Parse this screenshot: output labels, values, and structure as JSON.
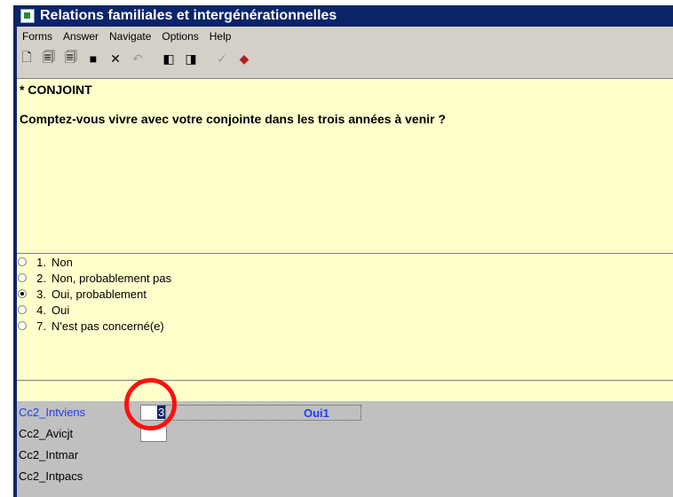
{
  "window": {
    "title": "Relations familiales et intergénérationnelles"
  },
  "menu": [
    "Forms",
    "Answer",
    "Navigate",
    "Options",
    "Help"
  ],
  "toolbar": [
    {
      "icon": "new-doc-icon",
      "glyph": "🗋"
    },
    {
      "icon": "page-icon",
      "glyph": "🗐"
    },
    {
      "icon": "copy-pages-icon",
      "glyph": "🗐"
    },
    {
      "icon": "save-icon",
      "glyph": "■"
    },
    {
      "icon": "delete-icon",
      "glyph": "✕"
    },
    {
      "icon": "undo-icon",
      "glyph": "↶"
    },
    {
      "icon": "prev-form-icon",
      "glyph": "◧"
    },
    {
      "icon": "next-form-icon",
      "glyph": "◨"
    },
    {
      "icon": "check-icon",
      "glyph": "✓"
    },
    {
      "icon": "eraser-icon",
      "glyph": "◆"
    }
  ],
  "question": {
    "heading": "* CONJOINT",
    "text": "Comptez-vous vivre avec votre conjointe dans les trois années à venir ?"
  },
  "answers": [
    {
      "num": "1.",
      "label": "Non",
      "selected": false
    },
    {
      "num": "2.",
      "label": "Non, probablement pas",
      "selected": false
    },
    {
      "num": "3.",
      "label": "Oui, probablement",
      "selected": true
    },
    {
      "num": "4.",
      "label": "Oui",
      "selected": false
    },
    {
      "num": "7.",
      "label": "N'est pas concerné(e)",
      "selected": false
    }
  ],
  "fields": [
    {
      "name": "Cc2_Intviens",
      "value": "3",
      "result": "Oui1",
      "active": true
    },
    {
      "name": "Cc2_Avicjt",
      "value": "",
      "active": false
    },
    {
      "name": "Cc2_Intmar",
      "active": false
    },
    {
      "name": "Cc2_Intpacs",
      "active": false
    }
  ],
  "colors": {
    "title_bar": "#0a246a",
    "question_bg": "#ffffcc",
    "active_field": "#1f3cff",
    "highlight_circle": "#ff1010"
  }
}
